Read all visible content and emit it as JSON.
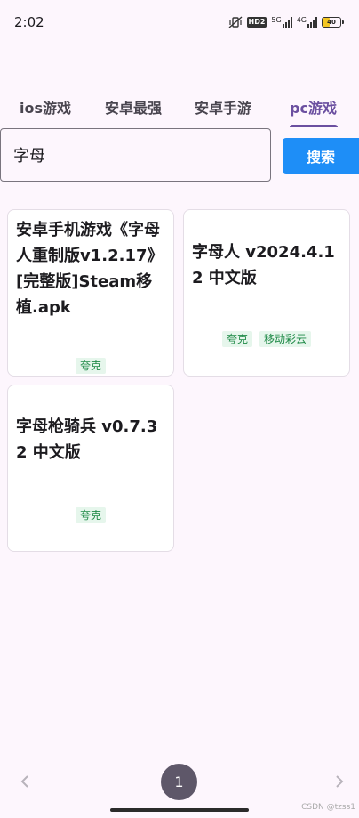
{
  "status_bar": {
    "time": "2:02",
    "hd_badge": "HD2",
    "network_1": "5G",
    "network_2": "4G",
    "battery": "40"
  },
  "tabs": [
    {
      "label": "ios游戏",
      "active": false
    },
    {
      "label": "安卓最强",
      "active": false
    },
    {
      "label": "安卓手游",
      "active": false
    },
    {
      "label": "pc游戏",
      "active": true
    }
  ],
  "search": {
    "value": "字母",
    "button_label": "搜索"
  },
  "results": [
    {
      "title": "安卓手机游戏《字母人重制版v1.2.17》[完整版]Steam移植.apk",
      "tags": [
        "夸克"
      ]
    },
    {
      "title": "字母人 v2024.4.12 中文版",
      "tags": [
        "夸克",
        "移动彩云"
      ]
    },
    {
      "title": "字母枪骑兵 v0.7.32 中文版",
      "tags": [
        "夸克"
      ]
    }
  ],
  "pagination": {
    "prev_icon": "chevron-left-icon",
    "current_page": "1",
    "next_icon": "chevron-right-icon"
  },
  "watermark": "CSDN @tzss1",
  "colors": {
    "accent": "#6b4fa0",
    "search_button": "#1e8ef7",
    "tag_text": "#1f8a47",
    "tag_bg": "#e6f6ec",
    "page_bg": "#fdf6fd"
  }
}
